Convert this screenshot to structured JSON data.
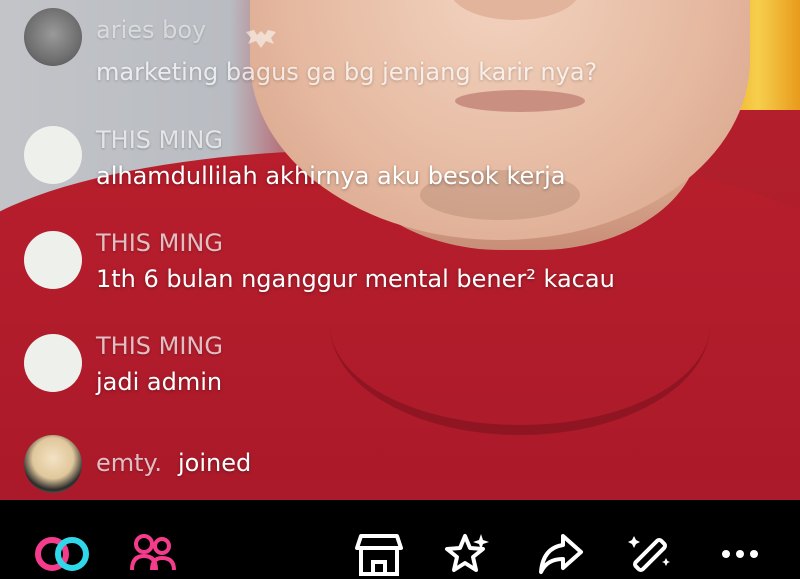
{
  "comments": [
    {
      "user": "aries boy",
      "text": "marketing bagus ga bg jenjang karir nya?"
    },
    {
      "user": "THIS MING",
      "text": "alhamdullilah akhirnya aku besok kerja"
    },
    {
      "user": "THIS MING",
      "text": "1th 6 bulan nganggur mental bener² kacau"
    },
    {
      "user": "THIS MING",
      "text": "jadi admin"
    }
  ],
  "join_event": {
    "user": "emty.",
    "action": "joined"
  },
  "toolbar": {
    "icons": [
      "link-loop-icon",
      "people-icon",
      "shop-icon",
      "sparkle-star-icon",
      "share-icon",
      "magic-wand-icon",
      "more-icon"
    ]
  },
  "colors": {
    "toolbar_bg": "#000000",
    "accent_pink": "#f53c8c",
    "accent_cyan": "#2ed8e8"
  }
}
